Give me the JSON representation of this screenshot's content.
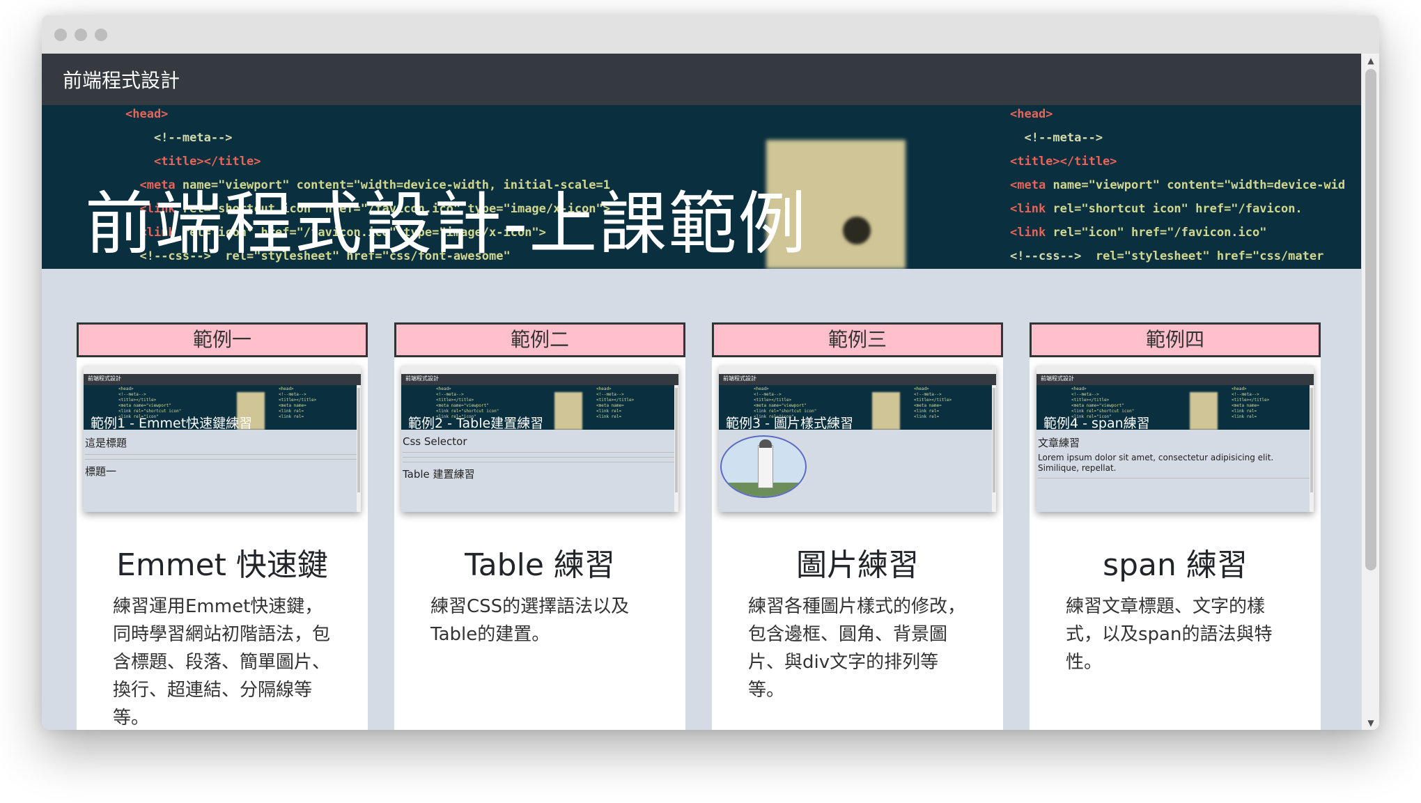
{
  "window": {
    "dots": [
      "close",
      "minimize",
      "maximize"
    ]
  },
  "navbar": {
    "brand": "前端程式設計"
  },
  "hero": {
    "title": "前端程式設計-上課範例"
  },
  "cards": [
    {
      "header": "範例一",
      "thumb_title": "範例1 - Emmet快速鍵練習",
      "thumb_heading": "這是標題",
      "thumb_heading2": "標題一",
      "title": "Emmet 快速鍵",
      "text": "練習運用Emmet快速鍵，同時學習網站初階語法，包含標題、段落、簡單圖片、換行、超連結、分隔線等等。"
    },
    {
      "header": "範例二",
      "thumb_title": "範例2 - Table建置練習",
      "thumb_heading": "Css Selector",
      "thumb_heading2": "Table 建置練習",
      "title": "Table 練習",
      "text": "練習CSS的選擇語法以及Table的建置。"
    },
    {
      "header": "範例三",
      "thumb_title": "範例3 - 圖片樣式練習",
      "thumb_heading": "",
      "thumb_heading2": "",
      "title": "圖片練習",
      "text": "練習各種圖片樣式的修改，包含邊框、圓角、背景圖片、與div文字的排列等等。"
    },
    {
      "header": "範例四",
      "thumb_title": "範例4 - span練習",
      "thumb_heading": "文章練習",
      "thumb_heading2": "Lorem ipsum dolor sit amet, consectetur adipisicing elit. Similique, repellat.",
      "title": "span 練習",
      "text": "練習文章標題、文字的樣式，以及span的語法與特性。"
    }
  ]
}
